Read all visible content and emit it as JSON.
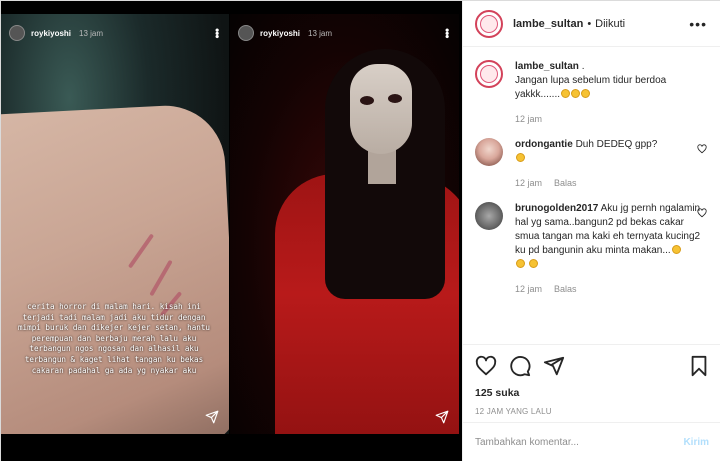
{
  "stories": [
    {
      "username": "roykiyoshi",
      "time": "13 jam",
      "caption": "cerita horror di malam hari. kisah ini terjadi tadi malam jadi aku tidur dengan mimpi buruk dan dikejer kejer setan, hantu perempuan dan berbaju merah lalu aku terbangun ngos ngosan dan alhasil aku terbangun & kaget lihat tangan ku bekas cakaran padahal ga ada yg nyakar aku"
    },
    {
      "username": "roykiyoshi",
      "time": "13 jam"
    }
  ],
  "post_header": {
    "username": "lambe_sultan",
    "separator": "•",
    "follow_status": "Diikuti",
    "more_icon": "more-horizontal-icon"
  },
  "caption": {
    "username": "lambe_sultan",
    "suffix": ".",
    "text": "Jangan lupa sebelum tidur berdoa yakkk.......",
    "time": "12 jam"
  },
  "comments": [
    {
      "username": "ordongantie",
      "text": "Duh DEDEQ gpp?",
      "time": "12 jam",
      "reply_label": "Balas"
    },
    {
      "username": "brunogolden2017",
      "text": "Aku jg pernh ngalamin hal yg sama..bangun2 pd bekas cakar smua tangan ma kaki eh ternyata kucing2 ku pd bangunin aku minta makan...",
      "time": "12 jam",
      "reply_label": "Balas"
    }
  ],
  "actions": {
    "likes": "125 suka",
    "posted": "12 JAM YANG LALU"
  },
  "add_comment": {
    "placeholder": "Tambahkan komentar...",
    "button": "Kirim"
  },
  "colors": {
    "brand_ring": "#d3425a",
    "link_disabled": "#b2dffc",
    "muted": "#8e8e8e"
  }
}
